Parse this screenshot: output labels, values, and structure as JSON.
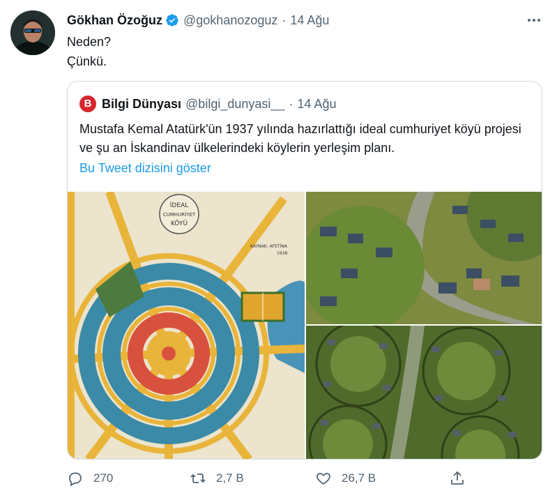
{
  "tweet": {
    "author_name": "Gökhan Özoğuz",
    "author_handle": "@gokhanozoguz",
    "separator": "·",
    "date": "14 Ağu",
    "text_lines": [
      "Neden?",
      "Çünkü."
    ]
  },
  "quoted_tweet": {
    "logo_letter": "B",
    "author_name": "Bilgi Dünyası",
    "author_handle": "@bilgi_dunyasi__",
    "separator": "·",
    "date": "14 Ağu",
    "text": "Mustafa Kemal Atatürk'ün 1937 yılında hazırlattığı ideal cumhuriyet köyü projesi ve şu an İskandinav ülkelerindeki köylerin yerleşim planı.",
    "thread_link": "Bu Tweet dizisini göster",
    "plan_image_text": {
      "title_line1": "İDEAL",
      "title_line2": "CUMHURİYET",
      "title_line3": "KÖYÜ",
      "side_note": "KAYNAK: AFETİNA",
      "side_year": "1938"
    }
  },
  "actions": {
    "replies": "270",
    "retweets": "2,7 B",
    "likes": "26,7 B"
  },
  "colors": {
    "accent": "#1d9bf0",
    "text": "#0f1419",
    "secondary": "#536471",
    "border": "#cfd9de",
    "logo": "#d7262c"
  }
}
